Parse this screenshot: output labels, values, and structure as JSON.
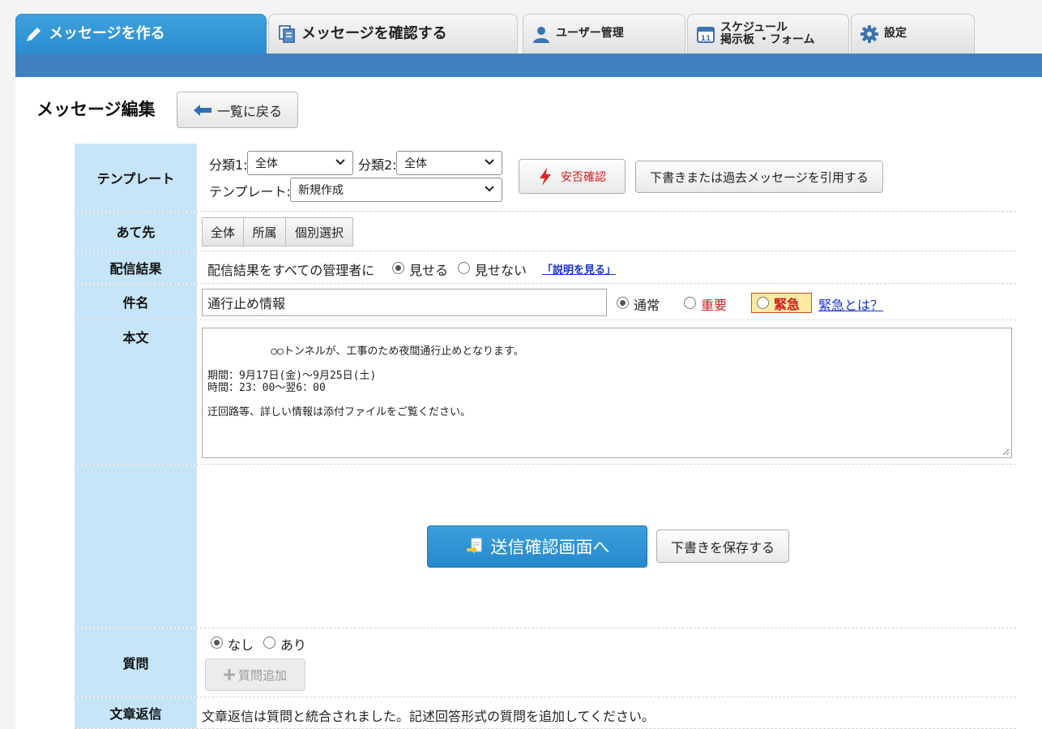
{
  "tabs": [
    {
      "label": "メッセージを作る",
      "icon": "pencil-icon",
      "active": true
    },
    {
      "label": "メッセージを確認する",
      "icon": "documents-icon",
      "active": false
    },
    {
      "label": "ユーザー管理",
      "icon": "user-icon",
      "active": false
    },
    {
      "label_line1": "スケジュール",
      "label_line2": "掲示板 ・フォーム",
      "icon": "calendar-icon",
      "active": false
    },
    {
      "label": "設定",
      "icon": "gear-icon",
      "active": false
    }
  ],
  "page": {
    "title": "メッセージ編集",
    "back_button": "一覧に戻る"
  },
  "template_row": {
    "label": "テンプレート",
    "cat1_label": "分類1:",
    "cat1_value": "全体",
    "cat2_label": "分類2:",
    "cat2_value": "全体",
    "template_label": "テンプレート:",
    "template_value": "新規作成",
    "safety_button": "安否確認",
    "quote_button": "下書きまたは過去メッセージを引用する"
  },
  "recipient_row": {
    "label": "あて先",
    "options": [
      "全体",
      "所属",
      "個別選択"
    ]
  },
  "result_row": {
    "label": "配信結果",
    "text": "配信結果をすべての管理者に",
    "options": [
      {
        "label": "見せる",
        "selected": true
      },
      {
        "label": "見せない",
        "selected": false
      }
    ],
    "help_link": "「説明を見る」"
  },
  "subject_row": {
    "label": "件名",
    "value": "通行止め情報",
    "priority": [
      {
        "label": "通常",
        "selected": true,
        "color": "#222222"
      },
      {
        "label": "重要",
        "selected": false,
        "color": "#d01c1c"
      },
      {
        "label": "緊急",
        "selected": false,
        "color": "#d01c1c"
      }
    ],
    "urgent_link": "緊急とは？"
  },
  "body_row": {
    "label": "本文",
    "value": "○○トンネルが、工事のため夜間通行止めとなります。\n\n期間：9月17日(金)～9月25日(土)\n時間：23：00～翌6：00\n\n迂回路等、詳しい情報は添付ファイルをご覧ください。"
  },
  "actions": {
    "send_button": "送信確認画面へ",
    "draft_button": "下書きを保存する"
  },
  "question_row": {
    "label": "質問",
    "options": [
      {
        "label": "なし",
        "selected": true
      },
      {
        "label": "あり",
        "selected": false
      }
    ],
    "add_button": "質問追加"
  },
  "reply_row": {
    "label": "文章返信",
    "text": "文章返信は質問と統合されました。記述回答形式の質問を追加してください。"
  },
  "colors": {
    "accent": "#2a8ccf",
    "bar": "#3e80c0",
    "label_bg": "#c7e5f8",
    "urgent_bg": "#ffeaa3",
    "danger": "#d01c1c"
  }
}
